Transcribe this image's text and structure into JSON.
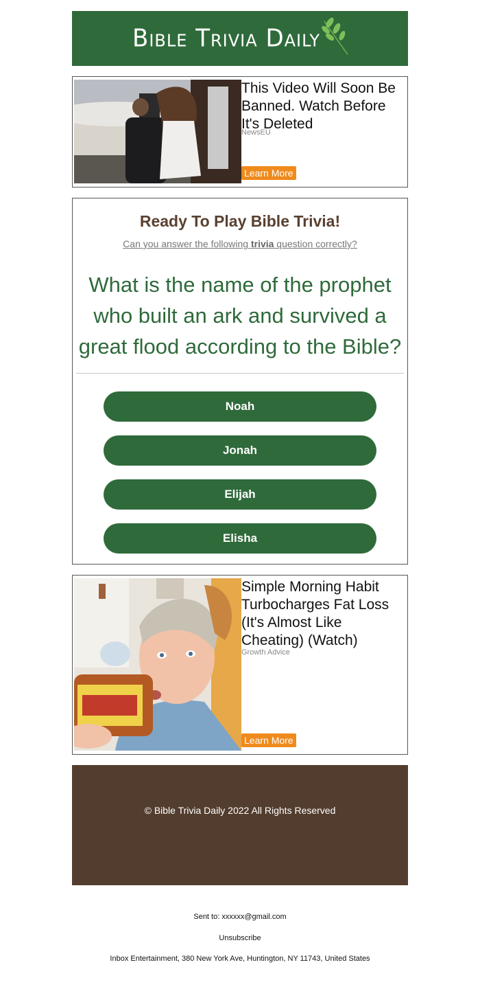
{
  "header": {
    "logo_text": "Bible Trivia Daily",
    "bg_color": "#2f6a3b"
  },
  "ads": [
    {
      "title": "This Video Will Soon Be Banned. Watch Before It's Deleted",
      "source": "NewsEU",
      "button_label": "Learn More",
      "image": "couple-boarding-private-jet-photo"
    },
    {
      "title": "Simple Morning Habit Turbocharges Fat Loss (It's Almost Like Cheating) (Watch)",
      "source": "Growth Advice",
      "button_label": "Learn More",
      "image": "woman-drinking-apple-cider-vinegar-photo"
    }
  ],
  "quiz": {
    "heading": "Ready To Play Bible Trivia!",
    "subtitle_before": "Can you answer the following ",
    "subtitle_bold": "trivia",
    "subtitle_after": " question correctly?",
    "question": "What is the name of the prophet who built an ark and survived a great flood according to the Bible?",
    "answers": [
      "Noah",
      "Jonah",
      "Elijah",
      "Elisha"
    ]
  },
  "footer": {
    "copyright": "© Bible Trivia Daily 2022 All Rights Reserved",
    "bg_color": "#533d2e"
  },
  "meta": {
    "sent_to": "Sent to: xxxxxx@gmail.com",
    "unsubscribe": "Unsubscribe",
    "address": "Inbox Entertainment, 380 New York Ave, Huntington, NY 11743, United States"
  },
  "colors": {
    "accent_orange": "#ef8a1c",
    "question_green": "#2f6a3b",
    "heading_brown": "#5a4030"
  }
}
